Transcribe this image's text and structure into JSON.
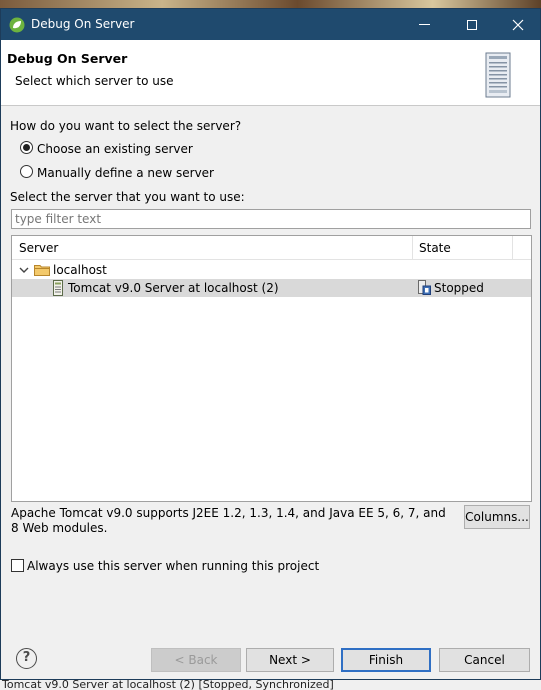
{
  "window": {
    "title": "Debug On Server"
  },
  "header": {
    "title": "Debug On Server",
    "subtitle": "Select which server to use"
  },
  "selection": {
    "question": "How do you want to select the server?",
    "options": [
      {
        "label": "Choose an existing server",
        "selected": true
      },
      {
        "label": "Manually define a new server",
        "selected": false
      }
    ]
  },
  "server_list": {
    "label": "Select the server that you want to use:",
    "filter_placeholder": "type filter text",
    "columns": [
      "Server",
      "State"
    ],
    "rows": [
      {
        "type": "host",
        "name": "localhost",
        "state": "",
        "icons": [
          "chevron-down-icon",
          "folder-icon"
        ]
      },
      {
        "type": "server",
        "name": "Tomcat v9.0 Server at localhost (2)",
        "state": "Stopped",
        "selected": true,
        "icons": [
          "server-icon",
          "stopped-state-icon"
        ]
      }
    ]
  },
  "description": "Apache Tomcat v9.0 supports J2EE 1.2, 1.3, 1.4, and Java EE 5, 6, 7, and 8 Web modules.",
  "columns_button": "Columns...",
  "always_use": {
    "label": "Always use this server when running this project",
    "checked": false
  },
  "buttons": {
    "back": "< Back",
    "next": "Next >",
    "finish": "Finish",
    "cancel": "Cancel"
  },
  "background_status": "Tomcat v9.0 Server at localhost (2)  [Stopped, Synchronized]",
  "colors": {
    "titlebar": "#1f4a6e",
    "dialog_bg": "#f0f0f0",
    "selected_row": "#d9d9d9",
    "default_button_border": "#2f6fc4"
  }
}
